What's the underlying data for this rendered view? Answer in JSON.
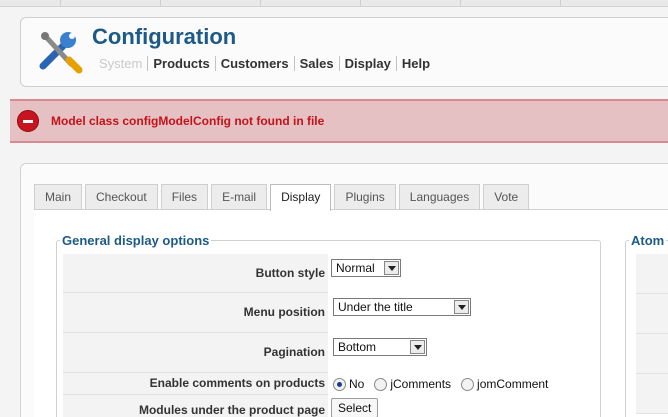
{
  "header": {
    "title": "Configuration",
    "submenu": [
      "System",
      "Products",
      "Customers",
      "Sales",
      "Display",
      "Help"
    ]
  },
  "error": {
    "message": "Model class configModelConfig not found in file"
  },
  "tabs": [
    "Main",
    "Checkout",
    "Files",
    "E-mail",
    "Display",
    "Plugins",
    "Languages",
    "Vote"
  ],
  "active_tab": "Display",
  "general": {
    "legend": "General display options",
    "button_style": {
      "label": "Button style",
      "value": "Normal"
    },
    "menu_position": {
      "label": "Menu position",
      "value": "Under the title"
    },
    "pagination": {
      "label": "Pagination",
      "value": "Bottom"
    },
    "comments": {
      "label": "Enable comments on products",
      "options": [
        "No",
        "jComments",
        "jomComment"
      ],
      "selected": "No"
    },
    "modules": {
      "label": "Modules under the product page",
      "button": "Select"
    }
  },
  "atom": {
    "legend": "Atom"
  },
  "colors": {
    "title": "#1d5a86",
    "error": "#c4121a",
    "error_bg": "#e6c1c3"
  }
}
